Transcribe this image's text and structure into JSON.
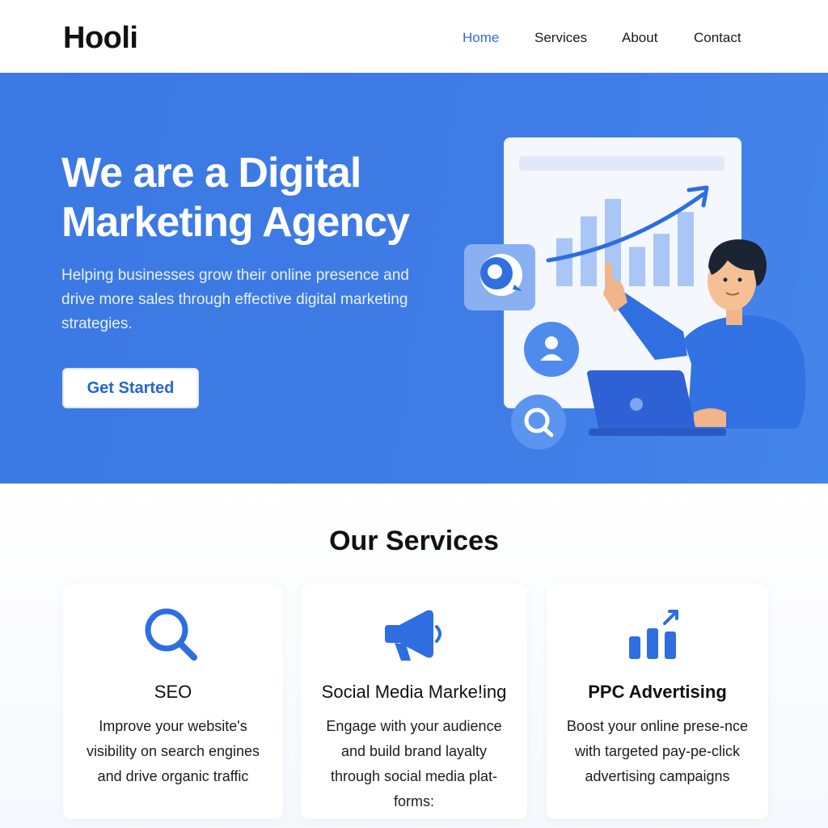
{
  "header": {
    "logo": "Hooli",
    "nav": [
      {
        "label": "Home",
        "active": true
      },
      {
        "label": "Services",
        "active": false
      },
      {
        "label": "About",
        "active": false
      },
      {
        "label": "Contact",
        "active": false
      }
    ]
  },
  "hero": {
    "title_line1": "We are a Digital",
    "title_line2": "Marketing Agency",
    "subtitle": "Helping businesses grow their online presence and drive more sales through effective digital marketing strategies.",
    "cta_label": "Get Started",
    "illustration": {
      "bar_levels": [
        0.55,
        0.8,
        1.0,
        0.45,
        0.6,
        0.85
      ],
      "icons": [
        "chat-bubble-icon",
        "user-icon",
        "search-bubble-icon",
        "laptop-icon",
        "trend-arrow-icon"
      ]
    }
  },
  "services": {
    "title": "Our Services",
    "items": [
      {
        "title": "SEO",
        "text": "Improve your website's visibility on search engines and drive organic traffic",
        "icon": "search-icon"
      },
      {
        "title": "Social Media Marke!ing",
        "text": "Engage with your audience and build brand layalty through social media plat-forms:",
        "icon": "megaphone-icon"
      },
      {
        "title": "PPC Advertising",
        "text": "Boost your online prese-nce with targeted pay-pe-click advertising campaigns",
        "icon": "bar-chart-icon"
      }
    ]
  },
  "colors": {
    "accent": "#2f6fe0",
    "hero_bg": "#3d7ae5",
    "icon_blue": "#2e6ee0",
    "card_bg": "#ffffff"
  }
}
